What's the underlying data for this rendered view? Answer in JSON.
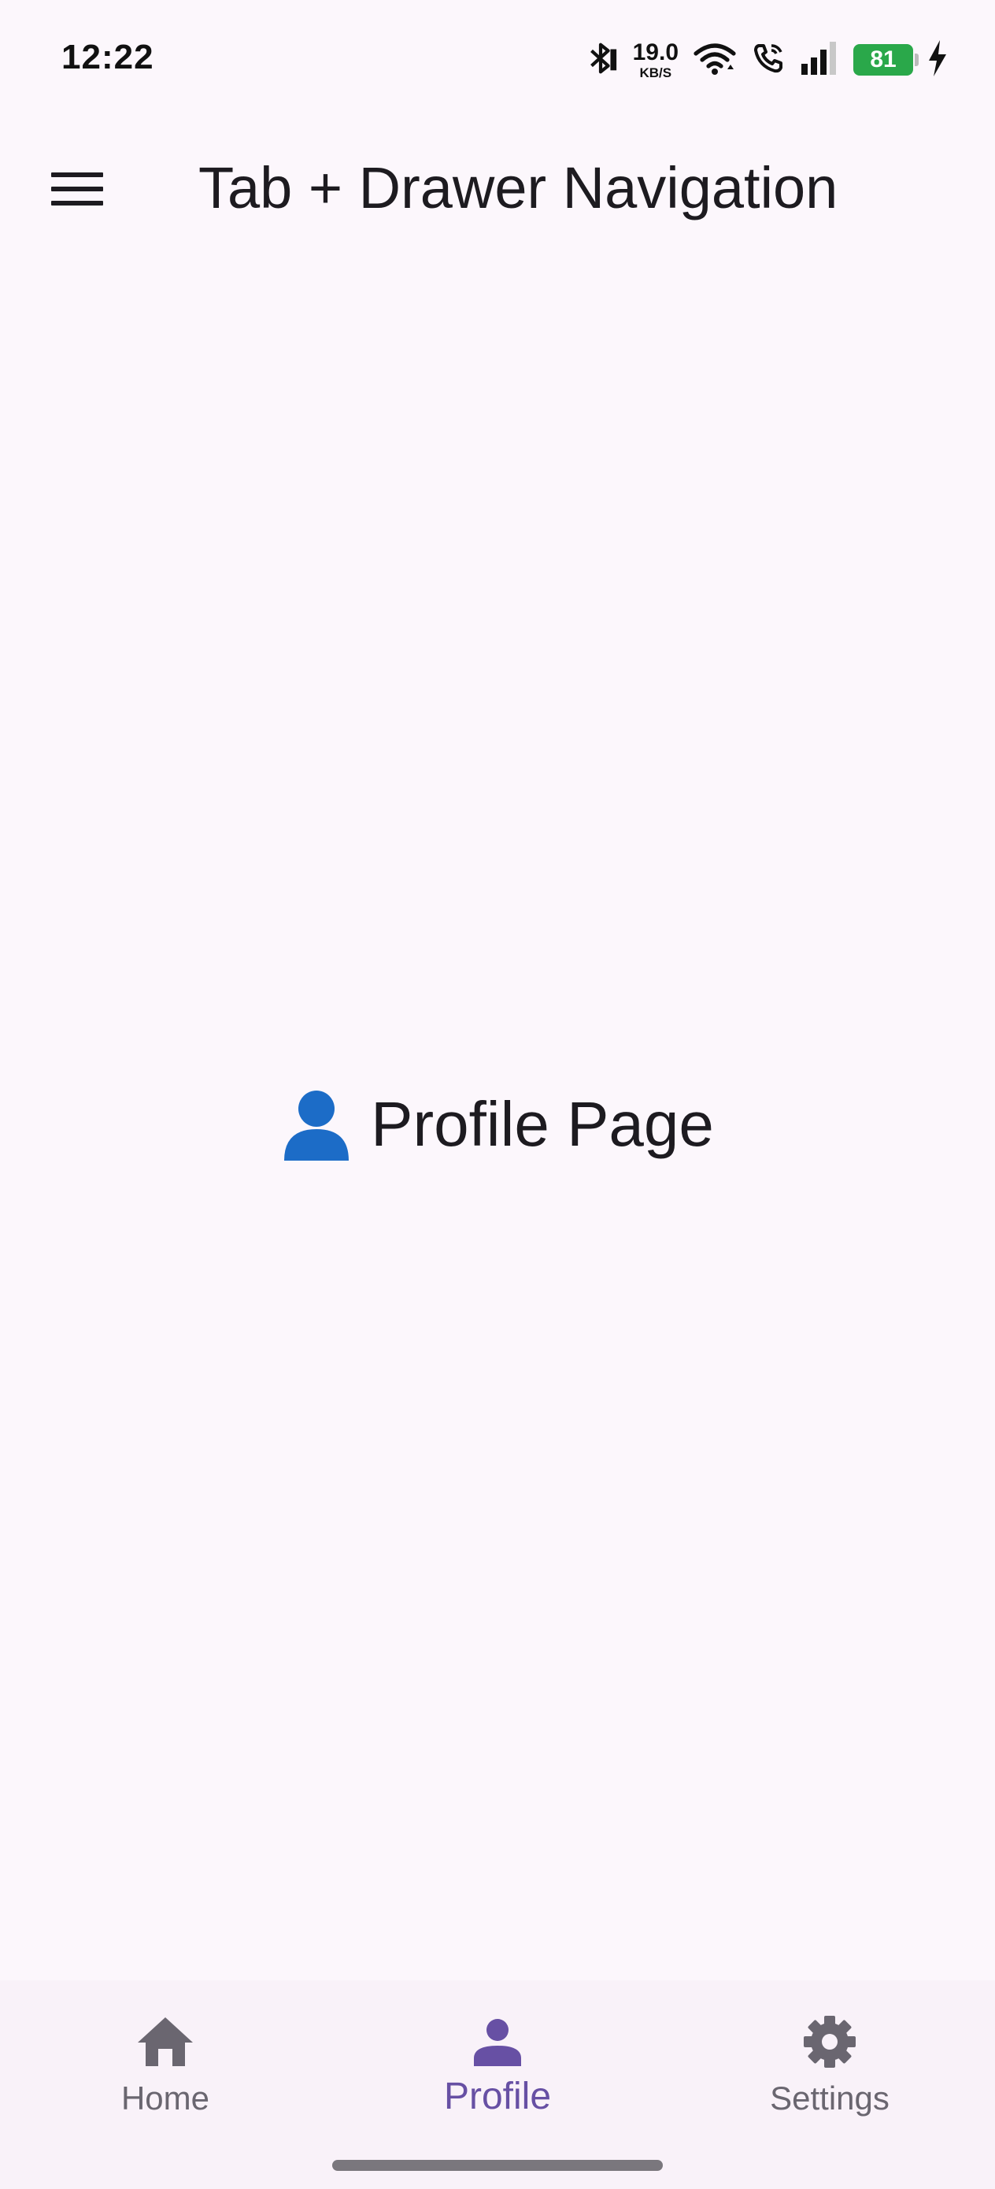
{
  "status_bar": {
    "time": "12:22",
    "net_speed_value": "19.0",
    "net_speed_unit": "KB/S",
    "battery_level": "81",
    "icons": [
      "bluetooth-icon",
      "wifi-icon",
      "wifi-call-icon",
      "signal-icon",
      "battery-icon",
      "charging-icon"
    ]
  },
  "app_bar": {
    "title": "Tab + Drawer Navigation",
    "menu_icon": "menu-icon"
  },
  "main": {
    "heading": "Profile Page",
    "heading_icon": "person-emoji-icon"
  },
  "bottom_nav": {
    "items": [
      {
        "label": "Home",
        "icon": "home-icon",
        "active": false
      },
      {
        "label": "Profile",
        "icon": "person-icon",
        "active": true
      },
      {
        "label": "Settings",
        "icon": "gear-icon",
        "active": false
      }
    ]
  },
  "colors": {
    "background": "#fcf7fc",
    "nav_background": "#f9f2f9",
    "accent": "#6750a4",
    "inactive": "#6a6670",
    "battery": "#2aa84a",
    "emoji_blue": "#1c6cc7"
  }
}
